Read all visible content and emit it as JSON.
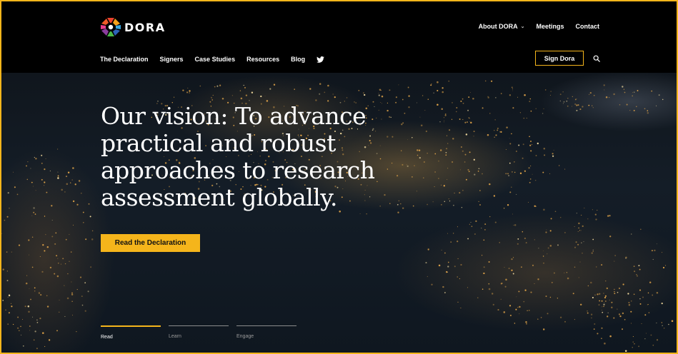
{
  "brand": {
    "name": "DORA",
    "accent_color": "#f5b51b"
  },
  "top_nav": [
    {
      "label": "About DORA",
      "has_dropdown": true
    },
    {
      "label": "Meetings"
    },
    {
      "label": "Contact"
    }
  ],
  "main_nav": [
    {
      "label": "The Declaration"
    },
    {
      "label": "Signers"
    },
    {
      "label": "Case Studies"
    },
    {
      "label": "Resources"
    },
    {
      "label": "Blog"
    }
  ],
  "social_icon": "twitter-icon",
  "sign_button": {
    "label": "Sign Dora"
  },
  "search": {
    "icon": "search-icon"
  },
  "hero": {
    "headline": "Our vision: To advance practical and robust approaches to research assessment globally.",
    "cta_label": "Read the Declaration",
    "tabs": [
      {
        "label": "Read",
        "active": true
      },
      {
        "label": "Learn",
        "active": false
      },
      {
        "label": "Engage",
        "active": false
      }
    ]
  }
}
